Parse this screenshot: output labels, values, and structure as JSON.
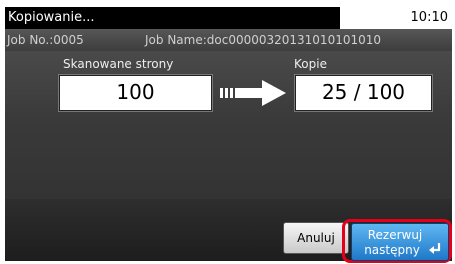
{
  "header": {
    "title": "Kopiowanie...",
    "time": "10:10"
  },
  "job": {
    "number": "Job No.:0005",
    "name": "Job Name:doc00000320131010101010"
  },
  "scanned": {
    "label": "Skanowane strony",
    "value": "100"
  },
  "copies": {
    "label": "Kopie",
    "value": "25 / 100"
  },
  "footer": {
    "cancel_label": "Anuluj",
    "reserve_line1": "Rezerwuj",
    "reserve_line2": "następny"
  },
  "colors": {
    "highlight": "#e4001b",
    "primary_button": "#2f8ad8",
    "background": "#3d3d3d"
  },
  "icons": {
    "arrow": "arrow-right-icon",
    "enter": "enter-icon"
  }
}
